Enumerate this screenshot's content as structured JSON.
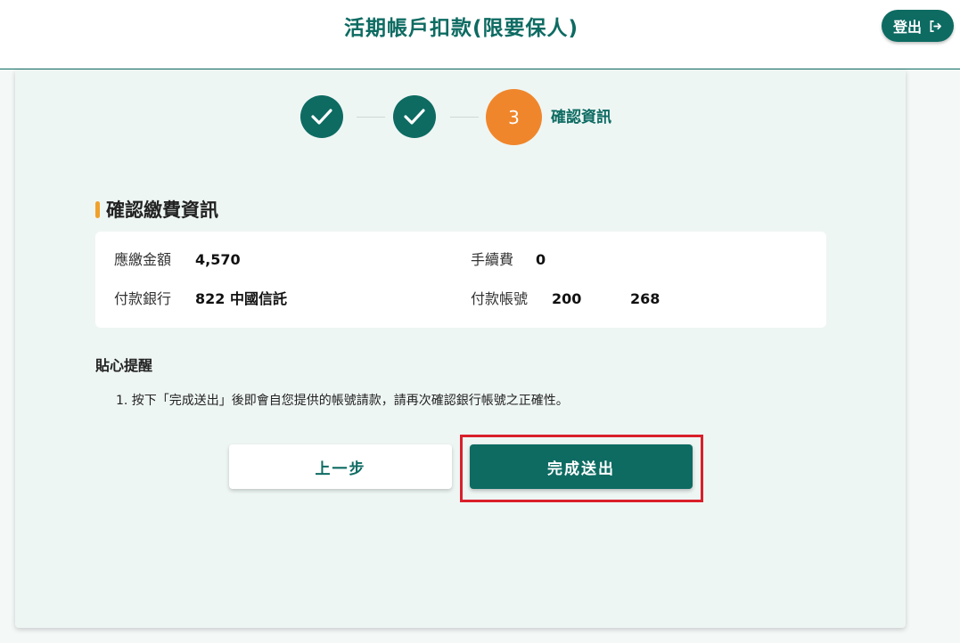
{
  "header": {
    "title": "活期帳戶扣款(限要保人)",
    "logout_label": "登出"
  },
  "steps": {
    "current_number": "3",
    "current_label": "確認資訊"
  },
  "section": {
    "title": "確認繳費資訊"
  },
  "info": {
    "amount_label": "應繳金額",
    "amount_value": "4,570",
    "fee_label": "手續費",
    "fee_value": "0",
    "bank_label": "付款銀行",
    "bank_value": "822 中國信託",
    "account_label": "付款帳號",
    "account_value_start": "200",
    "account_value_end": "268"
  },
  "reminder": {
    "title": "貼心提醒",
    "items": [
      "1. 按下「完成送出」後即會自您提供的帳號請款，請再次確認銀行帳號之正確性。"
    ]
  },
  "actions": {
    "prev_label": "上一步",
    "submit_label": "完成送出"
  },
  "colors": {
    "primary": "#0d6b62",
    "accent": "#f0862b",
    "highlight": "#d9202a"
  }
}
